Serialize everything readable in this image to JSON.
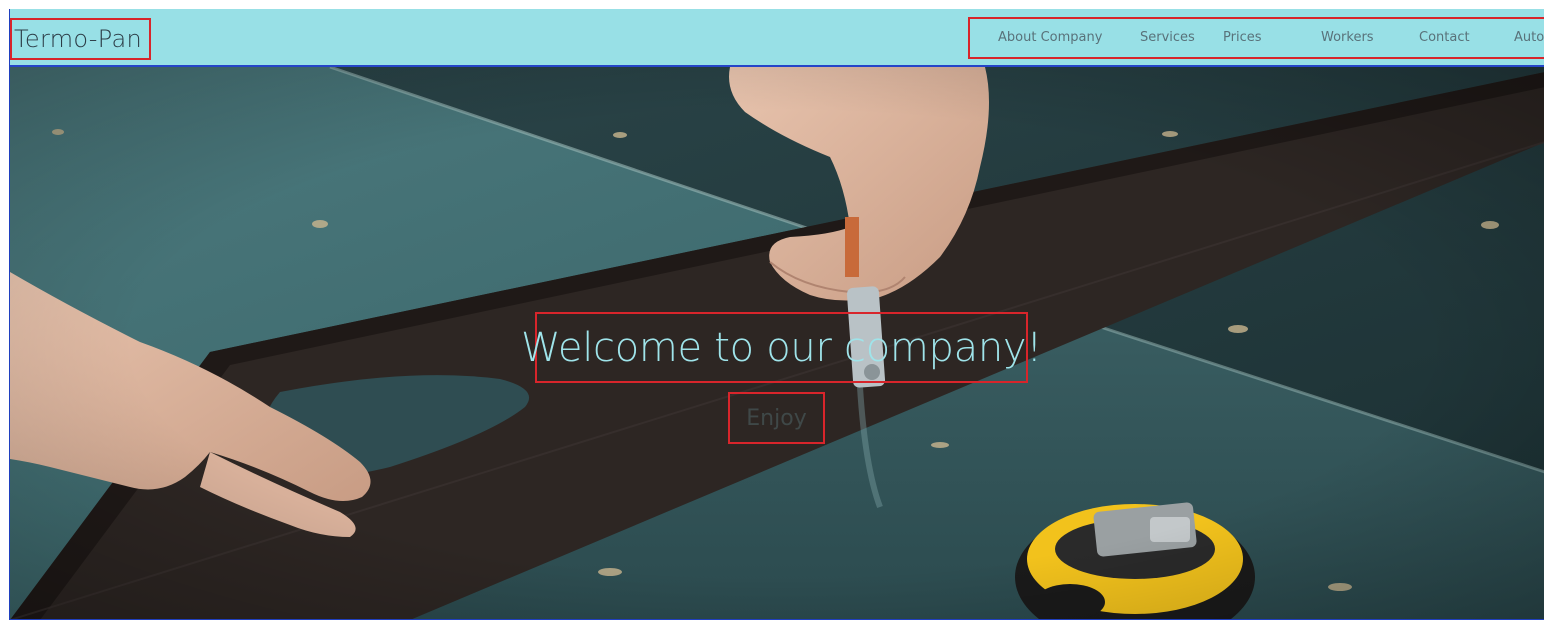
{
  "header": {
    "brand": "Termo-Pan",
    "nav": [
      {
        "label": "About Company"
      },
      {
        "label": "Services"
      },
      {
        "label": "Prices"
      },
      {
        "label": "Workers"
      },
      {
        "label": "Contact"
      },
      {
        "label": "Autor"
      }
    ]
  },
  "hero": {
    "title": "Welcome to our company!",
    "button_label": "Enjoy"
  },
  "colors": {
    "header_bg": "#98e0e6",
    "title_color": "#9fe4ea",
    "highlight_border": "#d8252b"
  }
}
